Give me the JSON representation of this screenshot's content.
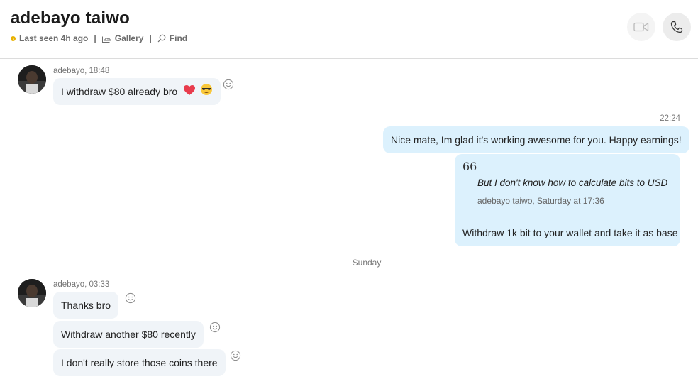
{
  "header": {
    "title": "adebayo taiwo",
    "last_seen": "Last seen 4h ago",
    "gallery": "Gallery",
    "find": "Find",
    "separator": "|"
  },
  "messages": {
    "m1_meta": "adebayo, 18:48",
    "m1_text": "I withdraw $80 already bro",
    "out_time": "22:24",
    "out1_text": "Nice mate, Im glad it's working awesome for you. Happy earnings!",
    "quote_mark": "66",
    "quote_text": "But I don't know how to calculate bits to USD",
    "quote_meta": "adebayo taiwo, Saturday at 17:36",
    "out2_text": "Withdraw 1k bit to your wallet and take it as base",
    "day_divider": "Sunday",
    "m2_meta": "adebayo, 03:33",
    "m2_text": "Thanks bro",
    "m3_text": "Withdraw another $80 recently",
    "m4_text": "I don't really store those coins there"
  },
  "colors": {
    "incoming_bubble": "#f0f4f8",
    "outgoing_bubble": "#dcf1fd",
    "status_dot": "#e8b100"
  },
  "icons": [
    "status-dot-icon",
    "gallery-icon",
    "search-icon",
    "video-call-icon",
    "phone-icon",
    "heart-emoji-icon",
    "sunglasses-emoji-icon",
    "smiley-react-icon",
    "quote-icon"
  ]
}
